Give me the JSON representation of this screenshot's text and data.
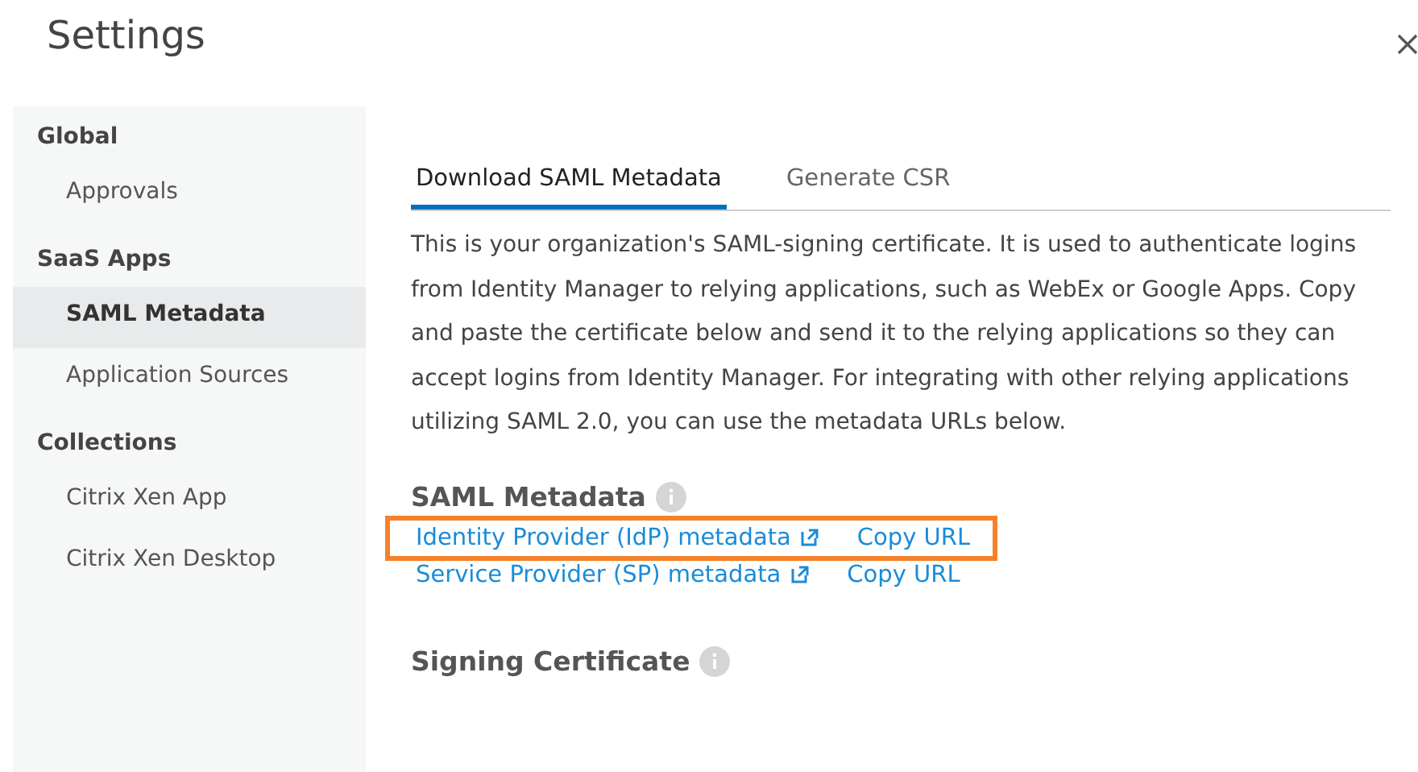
{
  "window": {
    "title": "Settings"
  },
  "sidebar": {
    "groups": [
      {
        "label": "Global",
        "items": [
          {
            "label": "Approvals",
            "selected": false
          }
        ]
      },
      {
        "label": "SaaS Apps",
        "items": [
          {
            "label": "SAML Metadata",
            "selected": true
          },
          {
            "label": "Application Sources",
            "selected": false
          }
        ]
      },
      {
        "label": "Collections",
        "items": [
          {
            "label": "Citrix Xen App",
            "selected": false
          },
          {
            "label": "Citrix Xen Desktop",
            "selected": false
          }
        ]
      }
    ]
  },
  "tabs": [
    {
      "label": "Download SAML Metadata",
      "selected": true
    },
    {
      "label": "Generate CSR",
      "selected": false
    }
  ],
  "description": "This is your organization's SAML-signing certificate. It is used to authenticate logins from Identity Manager to relying applications, such as WebEx or Google Apps. Copy and paste the certificate below and send it to the relying applications so they can accept logins from Identity Manager. For integrating with other relying applications utilizing SAML 2.0, you can use the metadata URLs below.",
  "saml_metadata": {
    "heading": "SAML Metadata",
    "links": [
      {
        "label": "Identity Provider (IdP) metadata",
        "copy": "Copy URL",
        "highlighted": true
      },
      {
        "label": "Service Provider (SP) metadata",
        "copy": "Copy URL",
        "highlighted": false
      }
    ]
  },
  "signing_certificate": {
    "heading": "Signing Certificate"
  }
}
